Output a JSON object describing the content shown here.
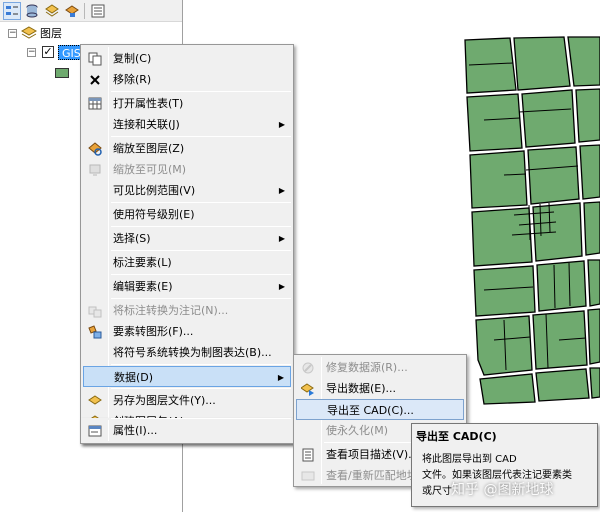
{
  "toc": {
    "root_label": "图层",
    "root_expander": "−",
    "layer_expander": "−",
    "layer_check": "✓",
    "layer_name": "GIS"
  },
  "context_menu": {
    "items": [
      {
        "label": "复制(C)",
        "icon": "copy-icon",
        "disabled": false
      },
      {
        "label": "移除(R)",
        "icon": "remove-x-icon",
        "disabled": false
      },
      {
        "label": "打开属性表(T)",
        "icon": "table-icon",
        "disabled": false
      },
      {
        "label": "连接和关联(J)",
        "icon": "none",
        "disabled": false,
        "submenu": true
      },
      {
        "label": "缩放至图层(Z)",
        "icon": "zoom-to-layer-icon",
        "disabled": false
      },
      {
        "label": "缩放至可见(M)",
        "icon": "zoom-visible-icon",
        "disabled": true
      },
      {
        "label": "可见比例范围(V)",
        "icon": "none",
        "disabled": false,
        "submenu": true
      },
      {
        "label": "使用符号级别(E)",
        "icon": "none",
        "disabled": false
      },
      {
        "label": "选择(S)",
        "icon": "none",
        "disabled": false,
        "submenu": true
      },
      {
        "label": "标注要素(L)",
        "icon": "none",
        "disabled": false
      },
      {
        "label": "编辑要素(E)",
        "icon": "none",
        "disabled": false,
        "submenu": true
      },
      {
        "label": "将标注转换为注记(N)...",
        "icon": "convert-labels-icon",
        "disabled": true
      },
      {
        "label": "要素转图形(F)...",
        "icon": "features-to-graphics-icon",
        "disabled": false
      },
      {
        "label": "将符号系统转换为制图表达(B)...",
        "icon": "none",
        "disabled": false
      },
      {
        "label": "数据(D)",
        "icon": "none",
        "disabled": false,
        "submenu": true,
        "highlighted": true
      },
      {
        "label": "另存为图层文件(Y)...",
        "icon": "layer-file-icon",
        "disabled": false
      },
      {
        "label": "创建图层包(A)...",
        "icon": "layer-package-icon",
        "disabled": false
      },
      {
        "label": "属性(I)...",
        "icon": "properties-icon",
        "disabled": false
      }
    ],
    "submenu_arrow": "▶"
  },
  "data_submenu": {
    "items": [
      {
        "label": "修复数据源(R)...",
        "icon": "repair-source-icon",
        "disabled": true
      },
      {
        "label": "导出数据(E)...",
        "icon": "export-data-icon",
        "disabled": false
      },
      {
        "label": "导出至 CAD(C)...",
        "icon": "none",
        "disabled": false,
        "highlighted": true
      },
      {
        "label": "使永久化(M)",
        "icon": "none",
        "disabled": true
      },
      {
        "label": "查看项目描述(V)...",
        "icon": "item-description-icon",
        "disabled": false
      },
      {
        "label": "查看/重新匹配地址",
        "icon": "rematch-address-icon",
        "disabled": true
      }
    ]
  },
  "tooltip": {
    "title": "导出至 CAD(C)",
    "line1": "将此图层导出到 CAD",
    "line2": "文件。如果该图层代表注记要素类",
    "line3": "或尺寸"
  },
  "watermark": "知乎 @图新地球",
  "colors": {
    "parcel_fill": "#6faa6f",
    "menu_bg": "#f0f0f0",
    "highlight": "#c9e0f7",
    "selection": "#3399ff"
  }
}
